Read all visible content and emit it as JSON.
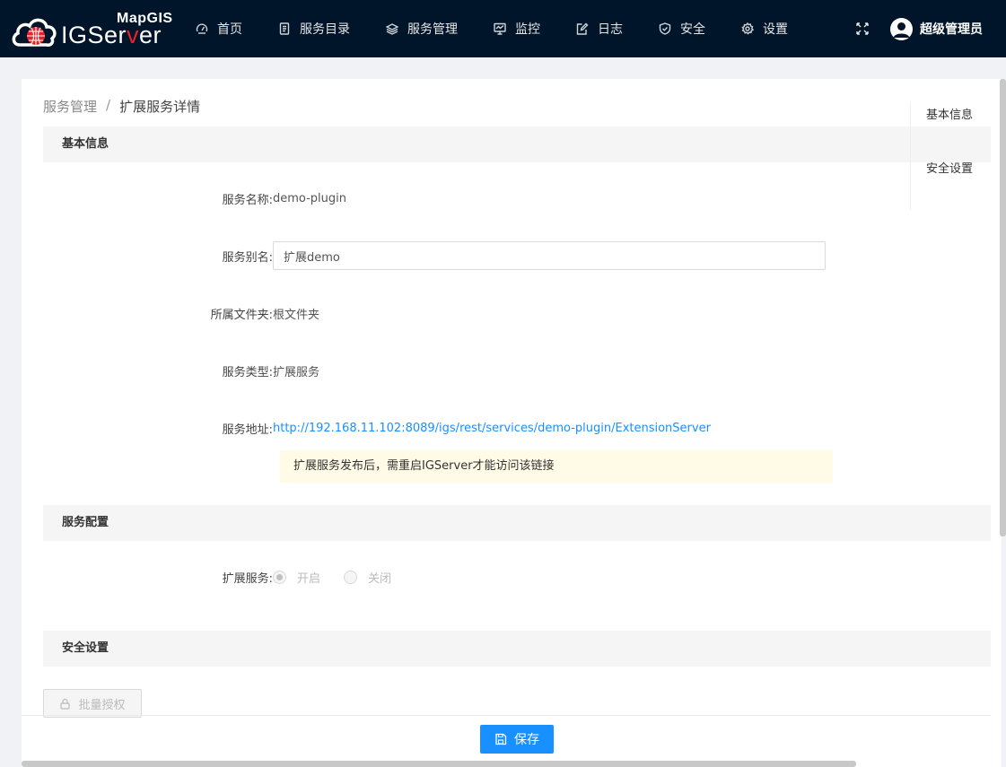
{
  "brand": {
    "top": "MapGIS",
    "name": "IGServer"
  },
  "nav": [
    {
      "label": "首页",
      "icon": "dashboard-icon"
    },
    {
      "label": "服务目录",
      "icon": "catalog-icon"
    },
    {
      "label": "服务管理",
      "icon": "layers-icon"
    },
    {
      "label": "监控",
      "icon": "monitor-icon"
    },
    {
      "label": "日志",
      "icon": "edit-log-icon"
    },
    {
      "label": "安全",
      "icon": "shield-icon"
    },
    {
      "label": "设置",
      "icon": "gear-icon"
    }
  ],
  "user": {
    "name": "超级管理员"
  },
  "breadcrumb": {
    "parent": "服务管理",
    "separator": "/",
    "current": "扩展服务详情"
  },
  "sections": {
    "basic": "基本信息",
    "config": "服务配置",
    "security": "安全设置"
  },
  "fields": {
    "service_name": {
      "label": "服务名称:",
      "value": "demo-plugin"
    },
    "alias": {
      "label": "服务别名:",
      "value": "扩展demo"
    },
    "folder": {
      "label": "所属文件夹:",
      "value": "根文件夹"
    },
    "type": {
      "label": "服务类型:",
      "value": "扩展服务"
    },
    "address": {
      "label": "服务地址:",
      "value": "http://192.168.11.102:8089/igs/rest/services/demo-plugin/ExtensionServer"
    },
    "tip": "扩展服务发布后，需重启IGServer才能访问该链接",
    "extension": {
      "label": "扩展服务:",
      "options": [
        "开启",
        "关闭"
      ],
      "selected": "开启"
    }
  },
  "buttons": {
    "batch_auth": "批量授权",
    "save": "保存"
  },
  "anchor": [
    "基本信息",
    "安全设置"
  ],
  "colors": {
    "header_bg": "#001529",
    "primary": "#1890ff",
    "tip_bg": "#fffbe6",
    "logo_red": "#e6212a"
  }
}
